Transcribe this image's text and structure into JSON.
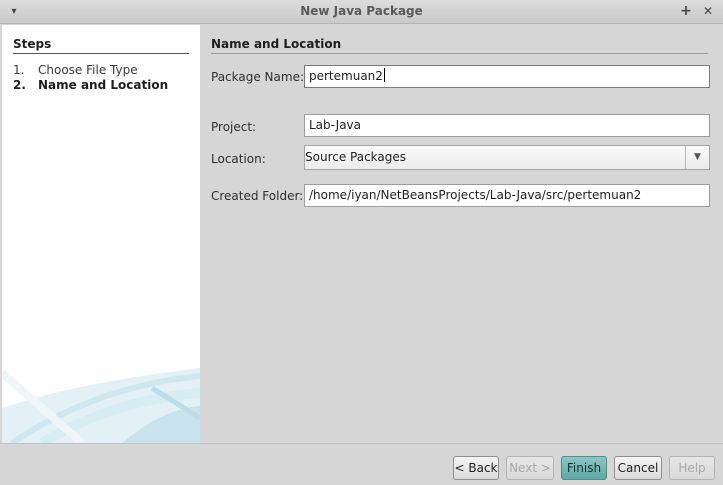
{
  "window": {
    "title": "New Java Package",
    "menu_glyph": "▾",
    "maximize_glyph": "+",
    "close_glyph": "✕"
  },
  "steps": {
    "heading": "Steps",
    "items": [
      {
        "num": "1.",
        "label": "Choose File Type"
      },
      {
        "num": "2.",
        "label": "Name and Location"
      }
    ]
  },
  "form": {
    "section_title": "Name and Location",
    "package_name": {
      "label": "Package Name:",
      "value": "pertemuan2"
    },
    "project": {
      "label": "Project:",
      "value": "Lab-Java"
    },
    "location": {
      "label": "Location:",
      "value": "Source Packages"
    },
    "created_folder": {
      "label": "Created Folder:",
      "value": "/home/iyan/NetBeansProjects/Lab-Java/src/pertemuan2"
    }
  },
  "buttons": {
    "back": "< Back",
    "next": "Next >",
    "finish": "Finish",
    "cancel": "Cancel",
    "help": "Help"
  },
  "colors": {
    "primary_button": "#6fb5b1",
    "panel_bg": "#d6d6d6"
  }
}
